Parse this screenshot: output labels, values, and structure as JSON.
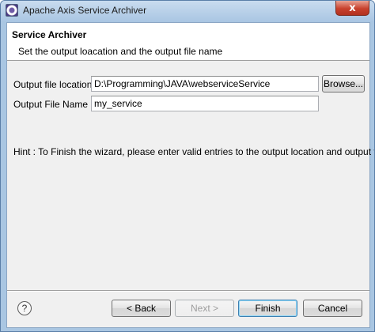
{
  "window": {
    "title": "Apache Axis Service Archiver",
    "close_glyph": "x"
  },
  "header": {
    "title": "Service Archiver",
    "description": "Set the output loacation and the output file name"
  },
  "form": {
    "output_location": {
      "label": "Output file location",
      "value": "D:\\Programming\\JAVA\\webserviceService"
    },
    "browse_label": "Browse...",
    "output_file_name": {
      "label": "Output File Name",
      "value": "my_service"
    }
  },
  "hint": "Hint : To Finish the wizard, please enter valid entries to the output location and output file.",
  "footer": {
    "help_glyph": "?",
    "back_label": "< Back",
    "next_label": "Next >",
    "finish_label": "Finish",
    "cancel_label": "Cancel"
  }
}
